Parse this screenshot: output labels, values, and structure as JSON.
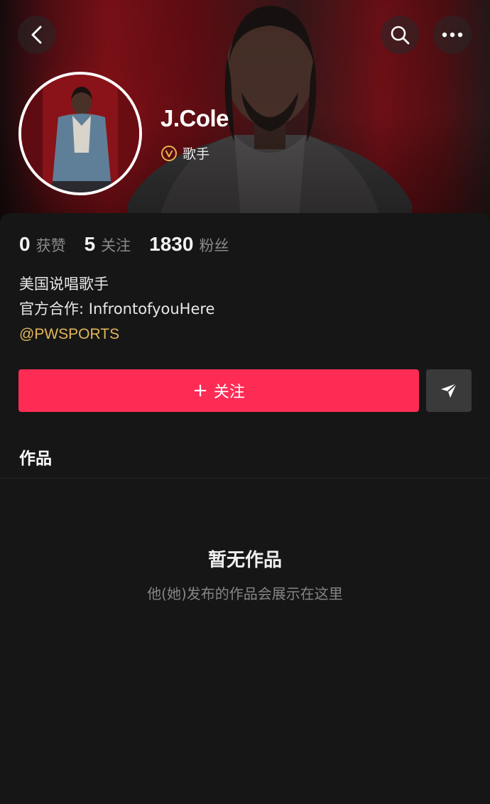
{
  "header": {
    "back_icon": "chevron-left-icon",
    "search_icon": "search-icon",
    "more_icon": "ellipsis-icon"
  },
  "profile": {
    "name": "J.Cole",
    "role": "歌手",
    "verified_icon": "verified-v-icon",
    "verified_color": "#e5b64a"
  },
  "stats": [
    {
      "value": "0",
      "label": "获赞"
    },
    {
      "value": "5",
      "label": "关注"
    },
    {
      "value": "1830",
      "label": "粉丝"
    }
  ],
  "bio": {
    "line1": "美国说唱歌手",
    "line2": "官方合作: InfrontofyouHere",
    "mention": "@PWSPORTS"
  },
  "actions": {
    "follow_plus": "+",
    "follow_label": "关注",
    "follow_color": "#fe2c55",
    "share_icon": "send-arrow-icon"
  },
  "tabs": {
    "works": "作品"
  },
  "empty_state": {
    "title": "暂无作品",
    "subtitle": "他(她)发布的作品会展示在这里"
  }
}
